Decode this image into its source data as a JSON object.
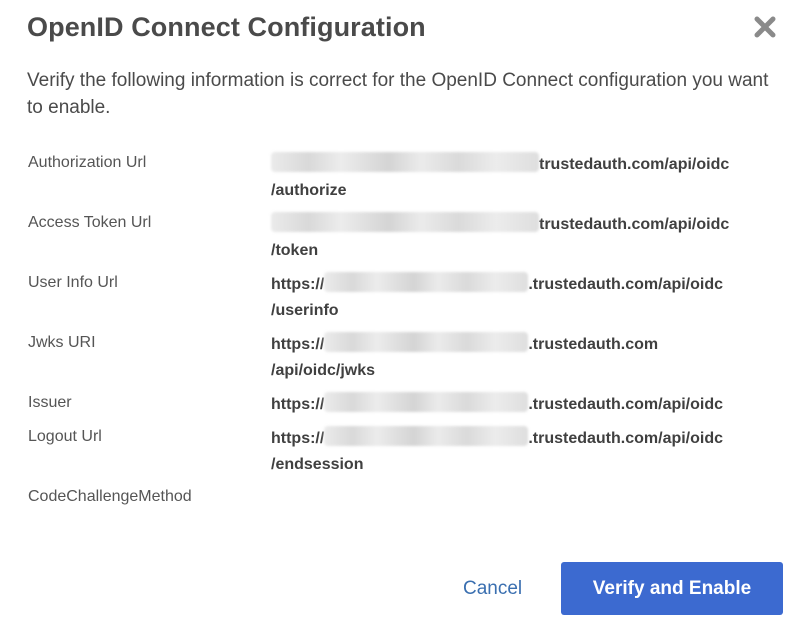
{
  "dialog": {
    "title": "OpenID Connect Configuration",
    "close_icon": "close-icon",
    "intro": "Verify the following information is correct for the OpenID Connect configuration you want to enable."
  },
  "fields": [
    {
      "label": "Authorization Url",
      "prefix": "",
      "value_line1": "trustedauth.com/api/oidc",
      "value_line2": "/authorize"
    },
    {
      "label": "Access Token Url",
      "prefix": "",
      "value_line1": "trustedauth.com/api/oidc",
      "value_line2": "/token"
    },
    {
      "label": "User Info Url",
      "prefix": "https://",
      "value_line1": ".trustedauth.com/api/oidc",
      "value_line2": "/userinfo"
    },
    {
      "label": "Jwks URI",
      "prefix": "https://",
      "value_line1": ".trustedauth.com",
      "value_line2": "/api/oidc/jwks"
    },
    {
      "label": "Issuer",
      "prefix": "https://",
      "value_line1": ".trustedauth.com/api/oidc",
      "value_line2": ""
    },
    {
      "label": "Logout Url",
      "prefix": "https://",
      "value_line1": ".trustedauth.com/api/oidc",
      "value_line2": "/endsession"
    },
    {
      "label": "CodeChallengeMethod",
      "prefix": "",
      "value_line1": "",
      "value_line2": ""
    }
  ],
  "buttons": {
    "cancel_label": "Cancel",
    "verify_label": "Verify and Enable"
  },
  "colors": {
    "primary": "#3c6ad0",
    "link": "#3a6fb0",
    "title": "#4a4a4a"
  }
}
